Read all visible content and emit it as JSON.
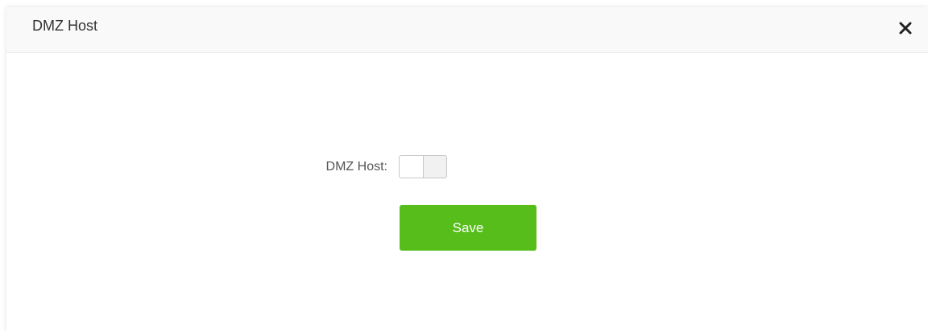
{
  "dialog": {
    "title": "DMZ Host",
    "close_icon": "close-icon"
  },
  "form": {
    "dmz_host_label": "DMZ Host:",
    "dmz_host_enabled": false
  },
  "actions": {
    "save_label": "Save"
  },
  "colors": {
    "save_button_bg": "#56bd1b",
    "header_bg": "#f9f9f9"
  }
}
